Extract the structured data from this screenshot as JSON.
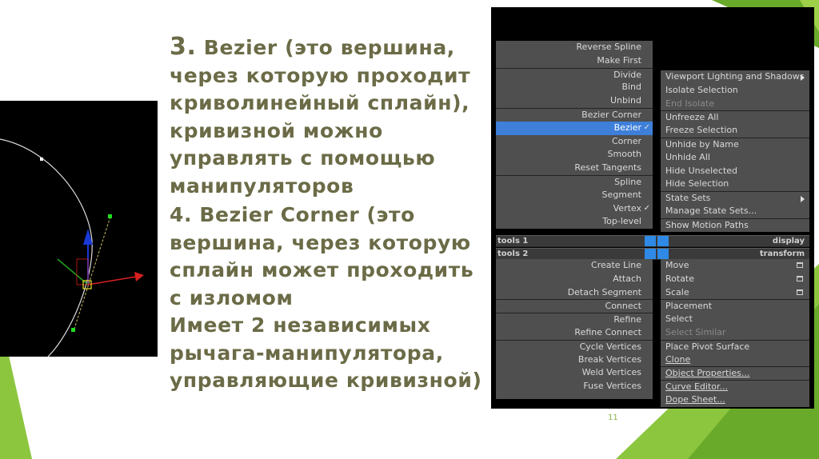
{
  "slide": {
    "paragraph1": {
      "number": "3.",
      "text": " Bezier (это вершина, через которую проходит криволинейный сплайн), кривизной можно управлять с помощью манипуляторов"
    },
    "paragraph2": "4. Bezier Corner (это вершина, через которую сплайн может проходить с изломом",
    "paragraph3": "Имеет 2 независимых рычага-манипулятора, управляющие кривизной)",
    "page_number": "11"
  },
  "colors": {
    "text": "#6b6b47",
    "green_dark": "#6aaa2a",
    "green_light": "#9fd04a",
    "highlight": "#3d7fd9"
  },
  "quad_menu": {
    "left_upper": [
      {
        "label": "Reverse Spline"
      },
      {
        "label": "Make First"
      },
      {
        "label": "Divide"
      },
      {
        "label": "Bind"
      },
      {
        "label": "Unbind"
      },
      {
        "label": "Bezier Corner"
      },
      {
        "label": "Bezier",
        "checked": true,
        "highlighted": true
      },
      {
        "label": "Corner"
      },
      {
        "label": "Smooth"
      },
      {
        "label": "Reset Tangents"
      },
      {
        "label": "Spline"
      },
      {
        "label": "Segment"
      },
      {
        "label": "Vertex",
        "checked": true
      },
      {
        "label": "Top-level"
      }
    ],
    "right_upper": [
      {
        "label": "Viewport Lighting and Shadows",
        "submenu": true
      },
      {
        "label": "Isolate Selection"
      },
      {
        "label": "End Isolate",
        "disabled": true
      },
      {
        "label": "Unfreeze All"
      },
      {
        "label": "Freeze Selection"
      },
      {
        "label": "Unhide by Name"
      },
      {
        "label": "Unhide All"
      },
      {
        "label": "Hide Unselected"
      },
      {
        "label": "Hide Selection"
      },
      {
        "label": "State Sets",
        "submenu": true
      },
      {
        "label": "Manage State Sets..."
      },
      {
        "label": "Show Motion Paths"
      }
    ],
    "bar1": {
      "left": "tools 1",
      "right": "display"
    },
    "bar2": {
      "left": "tools 2",
      "right": "transform"
    },
    "left_lower": [
      {
        "label": "Create Line"
      },
      {
        "label": "Attach"
      },
      {
        "label": "Detach Segment"
      },
      {
        "label": "Connect"
      },
      {
        "label": "Refine"
      },
      {
        "label": "Refine Connect"
      },
      {
        "label": "Cycle Vertices"
      },
      {
        "label": "Break Vertices"
      },
      {
        "label": "Weld Vertices"
      },
      {
        "label": "Fuse Vertices"
      }
    ],
    "right_lower": [
      {
        "label": "Move",
        "option": true
      },
      {
        "label": "Rotate",
        "option": true
      },
      {
        "label": "Scale",
        "option": true
      },
      {
        "label": "Placement"
      },
      {
        "label": "Select"
      },
      {
        "label": "Select Similar",
        "disabled": true
      },
      {
        "label": "Place Pivot Surface"
      },
      {
        "label": "Clone"
      },
      {
        "label": "Object Properties..."
      },
      {
        "label": "Curve Editor..."
      },
      {
        "label": "Dope Sheet..."
      }
    ]
  }
}
